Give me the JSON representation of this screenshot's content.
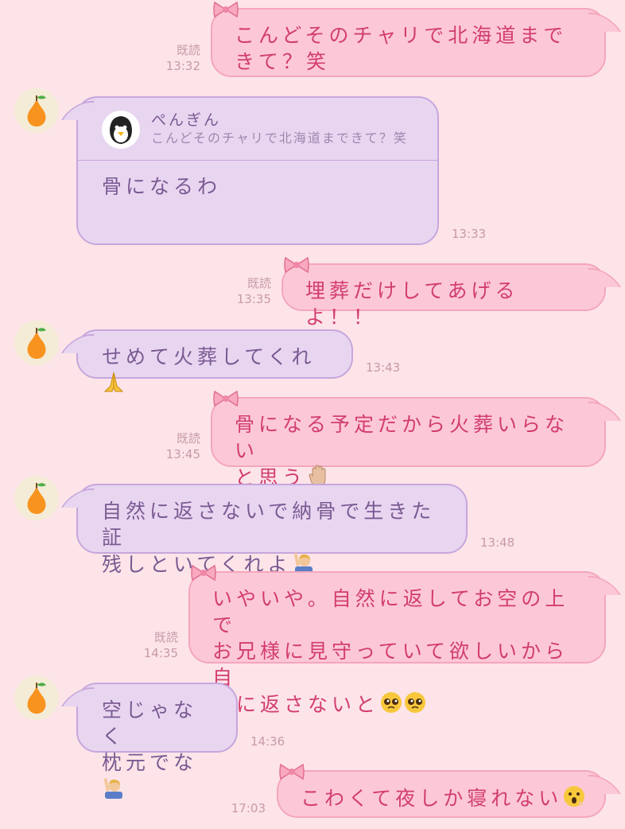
{
  "colors": {
    "background": "#fde4e8",
    "outgoing_bubble": "#fcc8d7",
    "outgoing_text": "#d23d70",
    "incoming_bubble": "#e8d6f1",
    "incoming_text": "#7a5a92",
    "meta_text": "#c79aa7"
  },
  "read_label": "既読",
  "messages": [
    {
      "dir": "out",
      "lines": [
        "こんどそのチャリで北海道まできて？笑"
      ],
      "read": "既読",
      "time": "13:32"
    },
    {
      "dir": "in",
      "quote": {
        "name": "ぺんぎん",
        "text": "こんどそのチャリで北海道まできて？笑"
      },
      "lines": [
        "骨になるわ"
      ],
      "time": "13:33",
      "avatar_icon": "pear-icon"
    },
    {
      "dir": "out",
      "lines": [
        "埋葬だけしてあげるよ！！"
      ],
      "read": "既読",
      "time": "13:35"
    },
    {
      "dir": "in",
      "lines": [
        "せめて火葬してくれ"
      ],
      "emoji": "folded-hands-emoji",
      "time": "13:43",
      "avatar_icon": "pear-icon"
    },
    {
      "dir": "out",
      "lines": [
        "骨になる予定だから火葬いらない",
        "と思う"
      ],
      "emoji": "raised-hand-emoji",
      "read": "既読",
      "time": "13:45"
    },
    {
      "dir": "in",
      "lines": [
        "自然に返さないで納骨で生きた証",
        "残しといてくれよ"
      ],
      "emoji": "person-raising-hand-emoji",
      "time": "13:48",
      "avatar_icon": "pear-icon"
    },
    {
      "dir": "out",
      "lines": [
        "いやいや。自然に返してお空の上で",
        "お兄様に見守っていて欲しいから自",
        "然に返さないと"
      ],
      "emoji": "pleading-face-emoji",
      "read": "既読",
      "time": "14:35"
    },
    {
      "dir": "in",
      "lines": [
        "空じゃなく",
        "枕元でな"
      ],
      "emoji": "person-raising-hand-emoji",
      "time": "14:36",
      "avatar_icon": "pear-icon"
    },
    {
      "dir": "out",
      "lines": [
        "こわくて夜しか寝れない"
      ],
      "emoji": "hushed-face-emoji",
      "time": "17:03"
    }
  ]
}
